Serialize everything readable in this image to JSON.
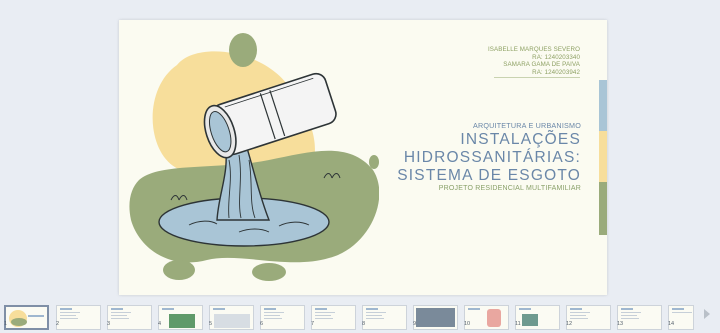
{
  "slide": {
    "authors": [
      "ISABELLE MARQUES SEVERO",
      "RA: 1240203340",
      "SAMARA GAMA DE PAIVA",
      "RA: 1240203942"
    ],
    "kicker": "ARQUITETURA E URBANISMO",
    "title_line1": "INSTALAÇÕES",
    "title_line2": "HIDROSSANITÁRIAS:",
    "title_line3": "SISTEMA DE ESGOTO",
    "subtitle": "PROJETO RESIDENCIAL MULTIFAMILIAR",
    "colors": {
      "background": "#fbfbf1",
      "title_blue": "#6a87a8",
      "green": "#9aab7b",
      "yellow": "#f7de9b",
      "blue": "#a9c5d6"
    }
  },
  "thumbnails": [
    {
      "number": "1",
      "kind": "title",
      "active": true
    },
    {
      "number": "2",
      "kind": "text"
    },
    {
      "number": "3",
      "kind": "text"
    },
    {
      "number": "4",
      "kind": "image"
    },
    {
      "number": "5",
      "kind": "diagram"
    },
    {
      "number": "6",
      "kind": "text"
    },
    {
      "number": "7",
      "kind": "text"
    },
    {
      "number": "8",
      "kind": "text"
    },
    {
      "number": "9",
      "kind": "photo"
    },
    {
      "number": "10",
      "kind": "image"
    },
    {
      "number": "11",
      "kind": "image"
    },
    {
      "number": "12",
      "kind": "text"
    },
    {
      "number": "13",
      "kind": "text"
    },
    {
      "number": "14",
      "kind": "text"
    }
  ],
  "icons": {
    "scroll_right": "chevron-right-icon"
  }
}
